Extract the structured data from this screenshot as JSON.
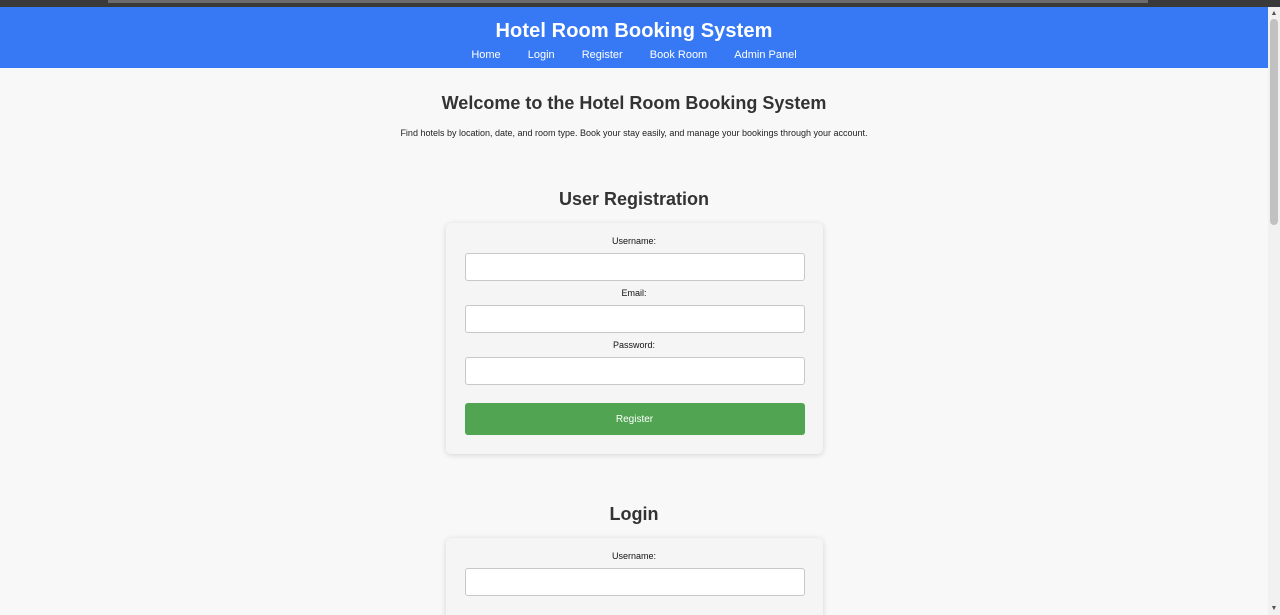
{
  "header": {
    "title": "Hotel Room Booking System",
    "nav": [
      "Home",
      "Login",
      "Register",
      "Book Room",
      "Admin Panel"
    ]
  },
  "intro": {
    "heading": "Welcome to the Hotel Room Booking System",
    "text": "Find hotels by location, date, and room type. Book your stay easily, and manage your bookings through your account."
  },
  "registration": {
    "title": "User Registration",
    "username_label": "Username:",
    "email_label": "Email:",
    "password_label": "Password:",
    "username_value": "",
    "email_value": "",
    "password_value": "",
    "submit_label": "Register"
  },
  "login": {
    "title": "Login",
    "username_label": "Username:",
    "username_value": ""
  },
  "colors": {
    "header_bg": "#3779f5",
    "button_bg": "#51a451",
    "page_bg": "#f8f8f8"
  },
  "icons": {
    "scroll_up": "scroll-up-arrow-icon",
    "scroll_down": "scroll-down-arrow-icon"
  }
}
